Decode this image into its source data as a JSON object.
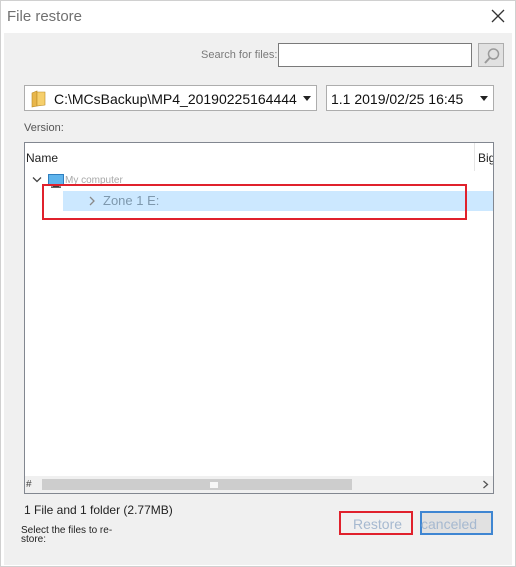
{
  "window": {
    "title": "File restore"
  },
  "search": {
    "label": "Search for files:",
    "value": "",
    "placeholder": ""
  },
  "backup_path": {
    "selected": "C:\\MCsBackup\\MP4_20190225164444"
  },
  "version_select": {
    "selected": "1.1   2019/02/25 16:45"
  },
  "version_label": "Version:",
  "tree": {
    "columns": [
      "Name",
      "Big"
    ],
    "root": {
      "label": "My computer",
      "expanded": true,
      "children": [
        {
          "label": "Zone 1 E:",
          "selected": true,
          "expanded": false
        }
      ]
    },
    "footer_mark": "#"
  },
  "summary": "1 File and 1 folder (2.77MB)",
  "hint": "Select the files to re- store:",
  "buttons": {
    "restore": "Restore",
    "cancel": "canceled"
  },
  "colors": {
    "highlight_border": "#e0212c",
    "selection_bg": "#cce8ff",
    "focus_border": "#3f86d2"
  }
}
